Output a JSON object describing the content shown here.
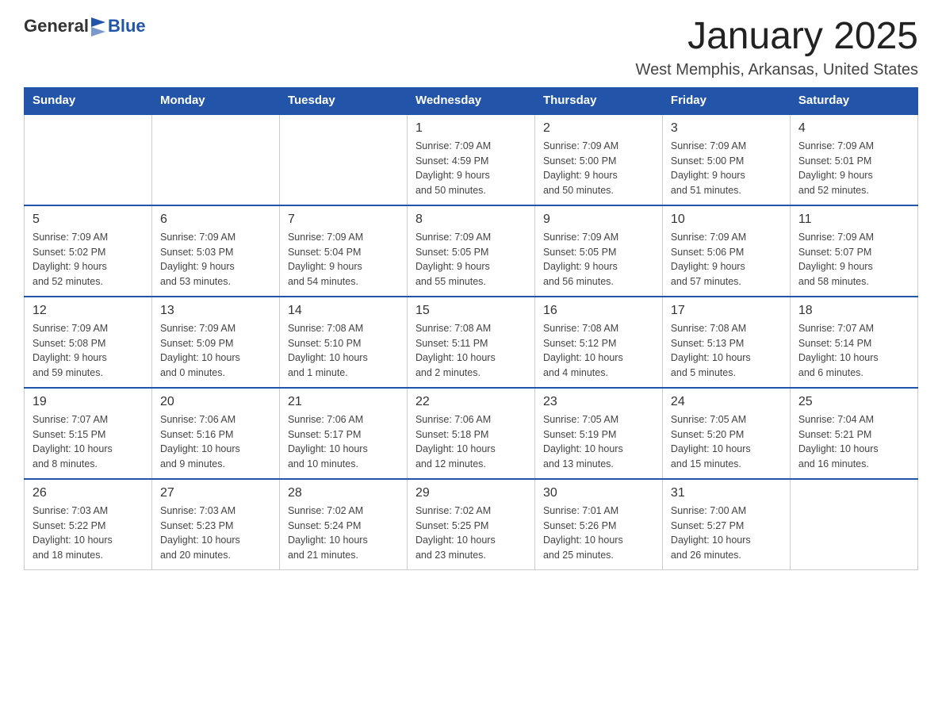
{
  "header": {
    "logo_general": "General",
    "logo_blue": "Blue",
    "month": "January 2025",
    "location": "West Memphis, Arkansas, United States"
  },
  "days_of_week": [
    "Sunday",
    "Monday",
    "Tuesday",
    "Wednesday",
    "Thursday",
    "Friday",
    "Saturday"
  ],
  "weeks": [
    [
      {
        "day": "",
        "info": ""
      },
      {
        "day": "",
        "info": ""
      },
      {
        "day": "",
        "info": ""
      },
      {
        "day": "1",
        "info": "Sunrise: 7:09 AM\nSunset: 4:59 PM\nDaylight: 9 hours\nand 50 minutes."
      },
      {
        "day": "2",
        "info": "Sunrise: 7:09 AM\nSunset: 5:00 PM\nDaylight: 9 hours\nand 50 minutes."
      },
      {
        "day": "3",
        "info": "Sunrise: 7:09 AM\nSunset: 5:00 PM\nDaylight: 9 hours\nand 51 minutes."
      },
      {
        "day": "4",
        "info": "Sunrise: 7:09 AM\nSunset: 5:01 PM\nDaylight: 9 hours\nand 52 minutes."
      }
    ],
    [
      {
        "day": "5",
        "info": "Sunrise: 7:09 AM\nSunset: 5:02 PM\nDaylight: 9 hours\nand 52 minutes."
      },
      {
        "day": "6",
        "info": "Sunrise: 7:09 AM\nSunset: 5:03 PM\nDaylight: 9 hours\nand 53 minutes."
      },
      {
        "day": "7",
        "info": "Sunrise: 7:09 AM\nSunset: 5:04 PM\nDaylight: 9 hours\nand 54 minutes."
      },
      {
        "day": "8",
        "info": "Sunrise: 7:09 AM\nSunset: 5:05 PM\nDaylight: 9 hours\nand 55 minutes."
      },
      {
        "day": "9",
        "info": "Sunrise: 7:09 AM\nSunset: 5:05 PM\nDaylight: 9 hours\nand 56 minutes."
      },
      {
        "day": "10",
        "info": "Sunrise: 7:09 AM\nSunset: 5:06 PM\nDaylight: 9 hours\nand 57 minutes."
      },
      {
        "day": "11",
        "info": "Sunrise: 7:09 AM\nSunset: 5:07 PM\nDaylight: 9 hours\nand 58 minutes."
      }
    ],
    [
      {
        "day": "12",
        "info": "Sunrise: 7:09 AM\nSunset: 5:08 PM\nDaylight: 9 hours\nand 59 minutes."
      },
      {
        "day": "13",
        "info": "Sunrise: 7:09 AM\nSunset: 5:09 PM\nDaylight: 10 hours\nand 0 minutes."
      },
      {
        "day": "14",
        "info": "Sunrise: 7:08 AM\nSunset: 5:10 PM\nDaylight: 10 hours\nand 1 minute."
      },
      {
        "day": "15",
        "info": "Sunrise: 7:08 AM\nSunset: 5:11 PM\nDaylight: 10 hours\nand 2 minutes."
      },
      {
        "day": "16",
        "info": "Sunrise: 7:08 AM\nSunset: 5:12 PM\nDaylight: 10 hours\nand 4 minutes."
      },
      {
        "day": "17",
        "info": "Sunrise: 7:08 AM\nSunset: 5:13 PM\nDaylight: 10 hours\nand 5 minutes."
      },
      {
        "day": "18",
        "info": "Sunrise: 7:07 AM\nSunset: 5:14 PM\nDaylight: 10 hours\nand 6 minutes."
      }
    ],
    [
      {
        "day": "19",
        "info": "Sunrise: 7:07 AM\nSunset: 5:15 PM\nDaylight: 10 hours\nand 8 minutes."
      },
      {
        "day": "20",
        "info": "Sunrise: 7:06 AM\nSunset: 5:16 PM\nDaylight: 10 hours\nand 9 minutes."
      },
      {
        "day": "21",
        "info": "Sunrise: 7:06 AM\nSunset: 5:17 PM\nDaylight: 10 hours\nand 10 minutes."
      },
      {
        "day": "22",
        "info": "Sunrise: 7:06 AM\nSunset: 5:18 PM\nDaylight: 10 hours\nand 12 minutes."
      },
      {
        "day": "23",
        "info": "Sunrise: 7:05 AM\nSunset: 5:19 PM\nDaylight: 10 hours\nand 13 minutes."
      },
      {
        "day": "24",
        "info": "Sunrise: 7:05 AM\nSunset: 5:20 PM\nDaylight: 10 hours\nand 15 minutes."
      },
      {
        "day": "25",
        "info": "Sunrise: 7:04 AM\nSunset: 5:21 PM\nDaylight: 10 hours\nand 16 minutes."
      }
    ],
    [
      {
        "day": "26",
        "info": "Sunrise: 7:03 AM\nSunset: 5:22 PM\nDaylight: 10 hours\nand 18 minutes."
      },
      {
        "day": "27",
        "info": "Sunrise: 7:03 AM\nSunset: 5:23 PM\nDaylight: 10 hours\nand 20 minutes."
      },
      {
        "day": "28",
        "info": "Sunrise: 7:02 AM\nSunset: 5:24 PM\nDaylight: 10 hours\nand 21 minutes."
      },
      {
        "day": "29",
        "info": "Sunrise: 7:02 AM\nSunset: 5:25 PM\nDaylight: 10 hours\nand 23 minutes."
      },
      {
        "day": "30",
        "info": "Sunrise: 7:01 AM\nSunset: 5:26 PM\nDaylight: 10 hours\nand 25 minutes."
      },
      {
        "day": "31",
        "info": "Sunrise: 7:00 AM\nSunset: 5:27 PM\nDaylight: 10 hours\nand 26 minutes."
      },
      {
        "day": "",
        "info": ""
      }
    ]
  ]
}
